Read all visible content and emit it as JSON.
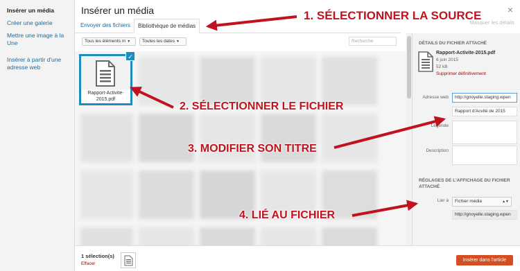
{
  "sidebar": {
    "items": [
      {
        "label": "Insérer un média"
      },
      {
        "label": "Créer une galerie"
      },
      {
        "label": "Mettre une image à la Une"
      },
      {
        "label": "Insérer à partir d'une adresse web"
      }
    ]
  },
  "modal": {
    "title": "Insérer un média",
    "close_symbol": "×",
    "hide_details": "Masquer les détails",
    "tabs": [
      {
        "label": "Envoyer des fichiers"
      },
      {
        "label": "Bibliothèque de médias"
      }
    ]
  },
  "toolbar": {
    "type_filter": "Tous les éléments m",
    "date_filter": "Toutes les dates",
    "search_placeholder": "Recherche"
  },
  "grid": {
    "selected_file_name": "Rapport-Activite-2015.pdf",
    "check_symbol": "✓"
  },
  "details": {
    "section_title": "Détails du fichier attaché",
    "file_name": "Rapport-Activite-2015.pdf",
    "date": "6 juin 2015",
    "size": "52 kB",
    "delete_label": "Supprimer définitivement",
    "fields": {
      "url_label": "Adresse web",
      "url_value": "http://gnoyelle.staging.wpen",
      "title_value": "Rapport d'Acvité de 2015",
      "caption_label": "Légende",
      "description_label": "Description"
    },
    "display_settings_title": "Réglages de l'affichage du fichier attaché",
    "link_label": "Lier à",
    "link_value": "Fichier média",
    "link_url": "http://gnoyelle.staging.wpen"
  },
  "footer": {
    "selection_count": "1 sélection(s)",
    "clear_label": "Effacer",
    "insert_label": "Insérer dans l'article"
  },
  "annotations": {
    "step1": "1. SÉLECTIONNER LA SOURCE",
    "step2": "2. SÉLECTIONNER LE FICHIER",
    "step3": "3. MODIFIER SON TITRE",
    "step4": "4. LIÉ AU FICHIER"
  },
  "colors": {
    "accent": "#1e8cbe",
    "annotation": "#c1121f",
    "primary_button": "#d54e21",
    "link": "#1e6ca0"
  }
}
